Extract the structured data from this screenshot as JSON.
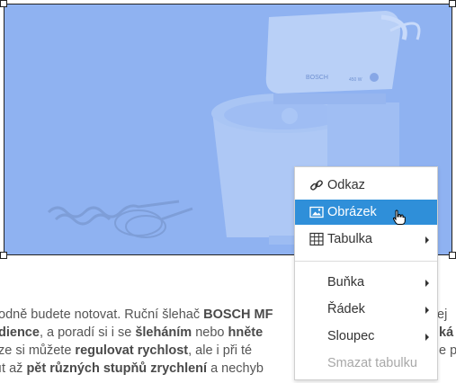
{
  "image": {
    "description_icon": "stand-mixer-image",
    "overlay_color": "#8fb2f1",
    "brand_text": "BOSCH",
    "power_text": "450 W"
  },
  "article": {
    "line1_a": "odně budete notovat. Ruční šlehač ",
    "line1_b": "BOSCH MF",
    "line1_c": "",
    "line1_tail": "ej",
    "line2_a": "",
    "line2_b": "dience",
    "line2_c": ", a poradí si i se ",
    "line2_d": "šleháním",
    "line2_e": " nebo ",
    "line2_f": "hněte",
    "line2_tail": "ká",
    "line3_a": "ze si můžete ",
    "line3_b": "regulovat rychlost",
    "line3_c": ", ale i při té ",
    "line3_tail": "e p",
    "line4_a": "ıt až ",
    "line4_b": "pět různých stupňů zrychlení",
    "line4_c": " a nechyb"
  },
  "context_menu": {
    "items": [
      {
        "label": "Odkaz",
        "icon": "link-icon"
      },
      {
        "label": "Obrázek",
        "icon": "image-icon"
      },
      {
        "label": "Tabulka",
        "icon": "table-icon"
      },
      {
        "label": "Buňka"
      },
      {
        "label": "Řádek"
      },
      {
        "label": "Sloupec"
      },
      {
        "label": "Smazat tabulku"
      }
    ],
    "active_color": "#2f8fd9",
    "disabled_color": "#a8a8a8"
  }
}
